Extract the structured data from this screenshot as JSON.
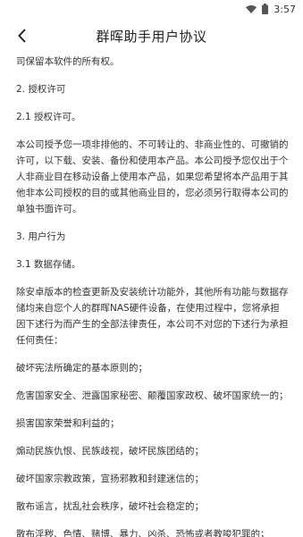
{
  "status": {
    "time": "3:57",
    "icons": [
      "wifi-icon",
      "battery-icon"
    ]
  },
  "header": {
    "title": "群晖助手用户协议",
    "back_icon": "chevron-left-icon"
  },
  "content": {
    "p0": "司保留本软件的所有权。",
    "h1": "2. 授权许可",
    "h1_1": "2.1 授权许可。",
    "p1": "本公司授予您一项非排他的、不可转让的、非商业性的、可撤销的许可，以下载、安装、备份和使用本产品。本公司授予您仅出于个人非商业目在移动设备上使用本产品，如果您希望将本产品用于其他非本公司授权的目的或其他商业目的，您必须另行取得本公司的单独书面许可。",
    "h2": "3. 用户行为",
    "h2_1": "3.1 数据存储。",
    "p2": "除安卓版本的检查更新及安装统计功能外，其他所有功能与数据存储均来自您个人的群晖NAS硬件设备，在使用过程中，您将承担因下述行为而产生的全部法律责任，本公司不对您的下述行为承担任何责任：",
    "items": [
      "破坏宪法所确定的基本原则的；",
      "危害国家安全、泄露国家秘密、颠覆国家政权、破坏国家统一的；",
      "损害国家荣誉和利益的；",
      "煽动民族仇恨、民族歧视，破坏民族团结的；",
      "破坏国家宗教政策，宣扬邪教和封建迷信的；",
      "散布谣言，扰乱社会秩序，破坏社会稳定的；",
      "散布淫秽、色情、赌博、暴力、凶杀、恐怖或者教唆犯罪的；"
    ]
  }
}
